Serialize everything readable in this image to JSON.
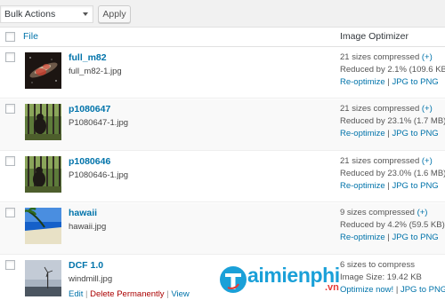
{
  "toolbar": {
    "bulk_actions": "Bulk Actions",
    "apply": "Apply"
  },
  "table": {
    "col_file": "File",
    "col_optimizer": "Image Optimizer"
  },
  "rows": [
    {
      "title": "full_m82",
      "filename": "full_m82-1.jpg",
      "line1": "21 sizes compressed",
      "line1_link": "(+)",
      "line2": "Reduced by 2.1% (109.6 KB)",
      "action1": "Re-optimize",
      "sep": " | ",
      "action2": "JPG to PNG"
    },
    {
      "title": "p1080647",
      "filename": "P1080647-1.jpg",
      "line1": "21 sizes compressed",
      "line1_link": "(+)",
      "line2": "Reduced by 23.1% (1.7 MB)",
      "action1": "Re-optimize",
      "sep": " | ",
      "action2": "JPG to PNG"
    },
    {
      "title": "p1080646",
      "filename": "P1080646-1.jpg",
      "line1": "21 sizes compressed",
      "line1_link": "(+)",
      "line2": "Reduced by 23.0% (1.6 MB)",
      "action1": "Re-optimize",
      "sep": " | ",
      "action2": "JPG to PNG"
    },
    {
      "title": "hawaii",
      "filename": "hawaii.jpg",
      "line1": "9 sizes compressed",
      "line1_link": "(+)",
      "line2": "Reduced by 4.2% (59.5 KB)",
      "action1": "Re-optimize",
      "sep": " | ",
      "action2": "JPG to PNG"
    },
    {
      "title": "DCF 1.0",
      "filename": "windmill.jpg",
      "line1": "6 sizes to compress",
      "line2": "Image Size: 19.42 KB",
      "action1": "Optimize now!",
      "sep": " | ",
      "action2": "JPG to PNG",
      "row_actions": {
        "edit": "Edit",
        "sep1": " | ",
        "delete": "Delete Permanently",
        "sep2": " | ",
        "view": "View"
      }
    }
  ],
  "watermark": {
    "brand": "aimienphi",
    "tld": ".vn"
  },
  "colors": {
    "link": "#0073aa",
    "delete": "#a00",
    "brand": "#1aa0d8",
    "tld": "#e53935"
  }
}
